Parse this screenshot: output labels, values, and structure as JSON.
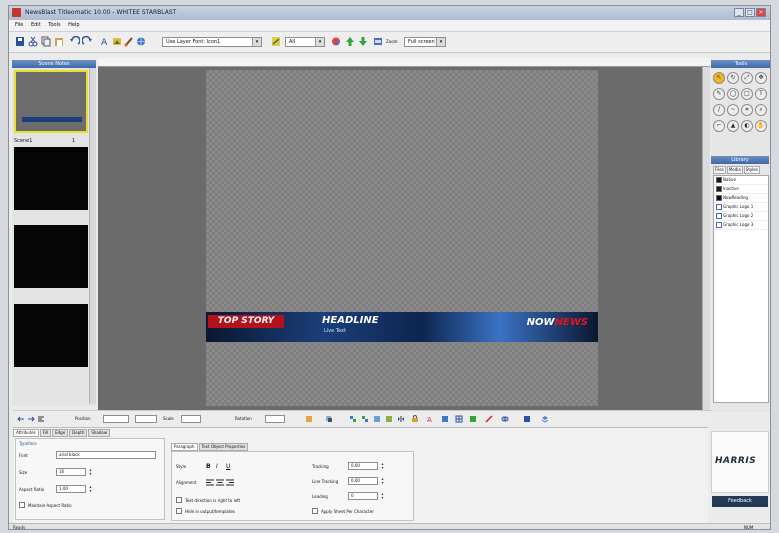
{
  "window": {
    "title": "NewsBlast Titleomatic 10.00 - WHITEE STARBLAST"
  },
  "menu": [
    "File",
    "Edit",
    "Tools",
    "Help"
  ],
  "toolbar": {
    "font_combo": "Use Layer Font: Icon1",
    "style_combo": "All",
    "zoom_label": "Zoom",
    "zoom_value": "Full screen"
  },
  "scenes_panel": {
    "title": "Scene Notes",
    "scene_label": "Scene1",
    "scene_count": "1"
  },
  "lower_third": {
    "top_story": "TOP STORY",
    "headline": "HEADLINE",
    "subline": "Live Text",
    "logo_now": "NOW",
    "logo_news": "NEWS"
  },
  "tools_panel": {
    "title": "Tools"
  },
  "library": {
    "title": "Library",
    "tabs": [
      "Files",
      "Media",
      "Styles"
    ],
    "items": [
      {
        "label": "Native",
        "color": "#1a1a1a"
      },
      {
        "label": "Inactive",
        "color": "#1a1a1a"
      },
      {
        "label": "NowReading",
        "color": "#111111"
      },
      {
        "label": "Graphic Logo 1",
        "color": "#4a63c4"
      },
      {
        "label": "Graphic Logo 2",
        "color": "#4a63c4"
      },
      {
        "label": "Graphic Logo 3",
        "color": "#4a63c4"
      }
    ]
  },
  "bottom_toolbar": {
    "position_label": "Position",
    "size_label": "Scale",
    "rotation_label": "Rotation"
  },
  "properties": {
    "tabs": [
      "Attributes",
      "Fill",
      "Edge",
      "Depth",
      "Shadow"
    ],
    "typeface_header": "Typeface",
    "font_label": "Font",
    "font_value": "arial black",
    "size_label": "Size",
    "size_value": "16",
    "aspect_label": "Aspect Ratio",
    "aspect_value": "1.00",
    "maintain_label": "Maintain Aspect Ratio",
    "para_tabs": [
      "Paragraph",
      "Text Object Properties"
    ],
    "style_label": "Style",
    "alignment_label": "Alignment",
    "bold_glyph": "B",
    "italic_glyph": "I",
    "underline_glyph": "U",
    "text_direction_label": "Text direction is right to left",
    "hidden_label": "Hide in output/templates",
    "tracking_label": "Tracking",
    "tracking_value": "0.00",
    "line_tracking_label": "Line Tracking",
    "line_tracking_value": "0.00",
    "leading_label": "Leading",
    "leading_value": "0",
    "apply_label": "Apply Sheet Per Character"
  },
  "brand": {
    "logo": "HARRIS",
    "feedback_label": "Feedback"
  },
  "status": {
    "left": "Ready",
    "right": "NUM"
  }
}
